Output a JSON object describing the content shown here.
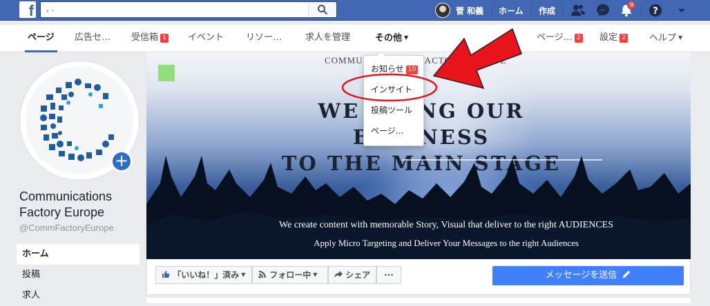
{
  "topbar": {
    "search_value": "             ,             .",
    "user_name": "菅 和義",
    "links": [
      "ホーム",
      "作成"
    ],
    "notifications_count": "9",
    "icons": [
      "facebook-logo",
      "search-icon",
      "friends-icon",
      "messenger-icon",
      "bell-icon",
      "help-icon",
      "caret-down-icon"
    ]
  },
  "pagenav": {
    "items": [
      {
        "label": "ページ",
        "active": true
      },
      {
        "label": "広告セ…"
      },
      {
        "label": "受信箱",
        "badge": "1"
      },
      {
        "label": "イベント"
      },
      {
        "label": "リソー…"
      },
      {
        "label": "求人を管理"
      },
      {
        "label": "その他"
      }
    ],
    "right_items": [
      {
        "label": "ページ…",
        "badge": "2"
      },
      {
        "label": "設定",
        "badge": "2"
      },
      {
        "label": "ヘルプ"
      }
    ]
  },
  "dropdown": {
    "items": [
      {
        "label": "お知らせ",
        "badge": "10"
      },
      {
        "label": "インサイト"
      },
      {
        "label": "投稿ツール"
      },
      {
        "label": "ページ…"
      }
    ]
  },
  "profile": {
    "name": "Communications Factory Europe",
    "handle": "@CommFactoryEurope"
  },
  "side_nav": [
    "ホーム",
    "投稿",
    "求人"
  ],
  "cover": {
    "top_text": "COMMUNICATIONS FACTORY EUROPE",
    "headline_1": "WE BRING OUR BUSINESS",
    "headline_2": "TO THE MAIN STAGE",
    "caption_1": "We create content with memorable Story, Visual that deliver to the right AUDIENCES",
    "caption_2": "Apply Micro Targeting and Deliver Your Messages to the right Audiences"
  },
  "actions": {
    "like": "「いいね！」済み",
    "follow": "フォロー中",
    "share": "シェア",
    "more": "···",
    "message": "メッセージを送信"
  },
  "colors": {
    "fb_blue": "#4267b2",
    "badge_red": "#fa3e3e",
    "annotation_red": "#e8141b",
    "message_button": "#4080ff"
  }
}
